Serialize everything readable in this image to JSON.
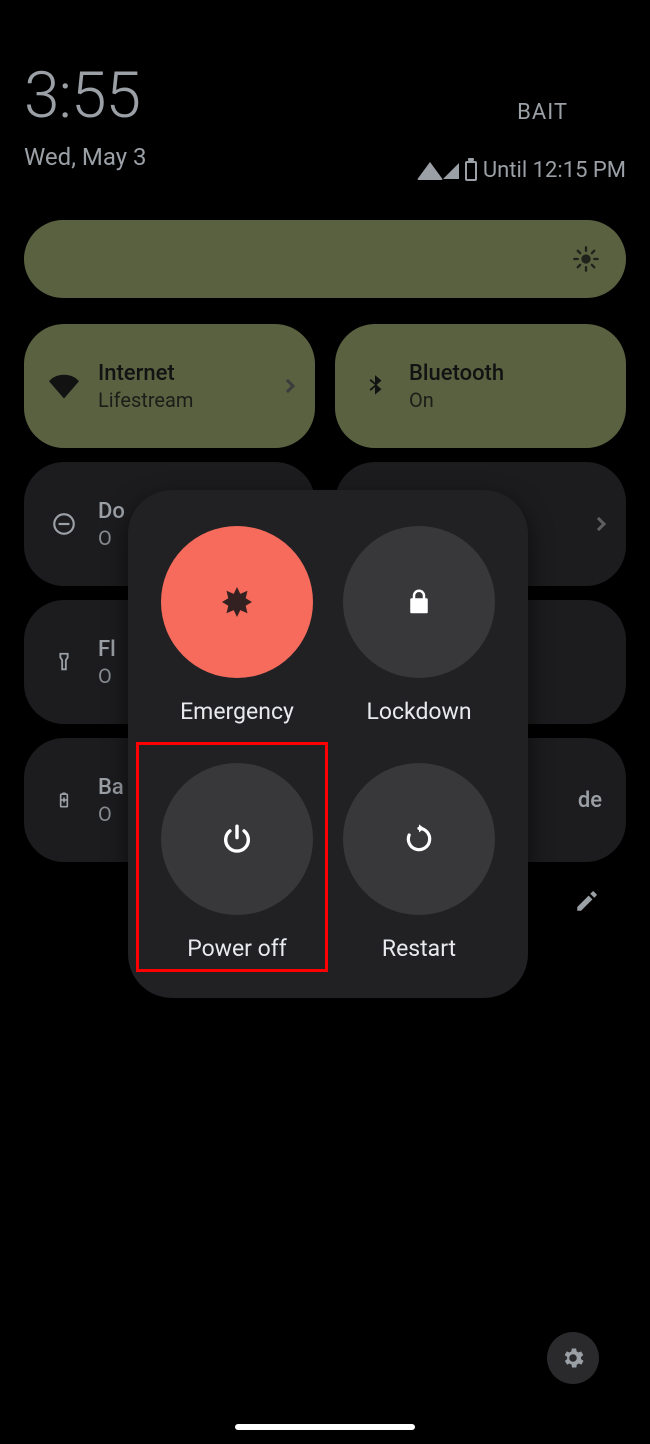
{
  "status": {
    "time": "3:55",
    "date": "Wed, May 3",
    "carrier": "BAIT",
    "battery_until": "Until 12:15 PM"
  },
  "tiles": {
    "internet": {
      "title": "Internet",
      "sub": "Lifestream"
    },
    "bluetooth": {
      "title": "Bluetooth",
      "sub": "On"
    },
    "dnd": {
      "title": "Do",
      "sub": "O"
    },
    "unknown": {
      "title": "",
      "sub": ""
    },
    "flash": {
      "title": "Fl",
      "sub": "O"
    },
    "battery": {
      "title": "Ba",
      "sub": "O"
    },
    "mode": {
      "title": "de",
      "sub": ""
    }
  },
  "power_menu": {
    "emergency": "Emergency",
    "lockdown": "Lockdown",
    "poweroff": "Power off",
    "restart": "Restart"
  },
  "colors": {
    "accent_tile": "#5a6141",
    "emergency": "#f66b5c",
    "highlight": "#ff0000"
  }
}
